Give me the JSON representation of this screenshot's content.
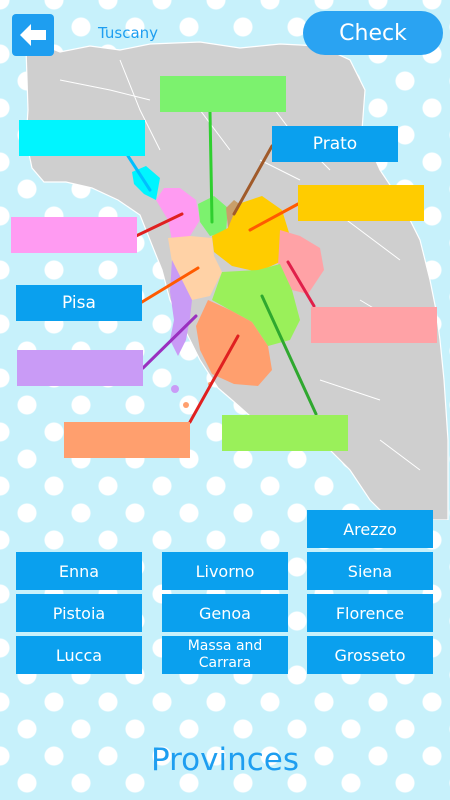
{
  "header": {
    "title": "Tuscany",
    "check_label": "Check"
  },
  "slots": [
    {
      "label": "",
      "color": "#7cf26e"
    },
    {
      "label": "",
      "color": "#00f5ff"
    },
    {
      "label": "Prato",
      "color": "#0aa0ee"
    },
    {
      "label": "",
      "color": "#ffcc00"
    },
    {
      "label": "",
      "color": "#ff9bf2"
    },
    {
      "label": "Pisa",
      "color": "#0aa0ee"
    },
    {
      "label": "",
      "color": "#ffa2a6"
    },
    {
      "label": "",
      "color": "#c99bf6"
    },
    {
      "label": "",
      "color": "#ff9f6e"
    },
    {
      "label": "",
      "color": "#9af05a"
    }
  ],
  "tiles": [
    {
      "label": "Arezzo"
    },
    {
      "label": "Enna"
    },
    {
      "label": "Livorno"
    },
    {
      "label": "Siena"
    },
    {
      "label": "Pistoia"
    },
    {
      "label": "Genoa"
    },
    {
      "label": "Florence"
    },
    {
      "label": "Lucca"
    },
    {
      "label": "Massa and Carrara"
    },
    {
      "label": "Grosseto"
    }
  ],
  "footer": {
    "title": "Provinces"
  },
  "colors": {
    "accent": "#1e9ef0",
    "tile": "#0aa0ee",
    "map_gray": "#cfcfcf"
  }
}
